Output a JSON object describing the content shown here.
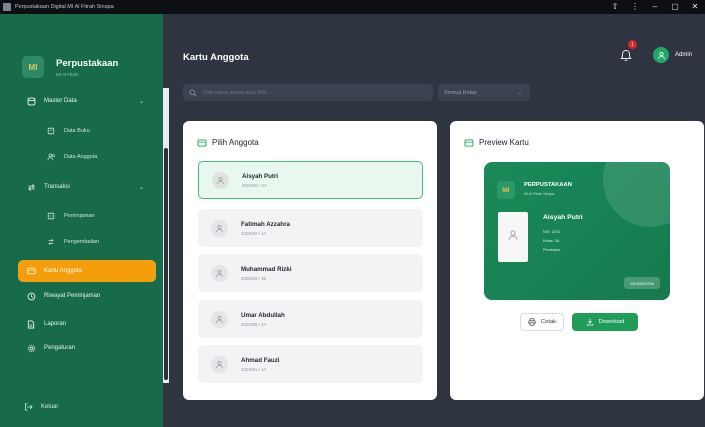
{
  "window": {
    "title": "Perpustakaan Digital MI Al Fitrah Sinapa",
    "controls": [
      "⇧",
      "⋮",
      "–",
      "▢",
      "✕"
    ]
  },
  "sidebar": {
    "brand_title": "Perpustakaan",
    "brand_subtitle": "MI Al Fitrah",
    "brand_logo": "MI",
    "items": [
      {
        "label": "Master Data",
        "icon": "database-icon",
        "expandable": true
      },
      {
        "label": "Data Buku",
        "icon": "book-icon",
        "sub": true
      },
      {
        "label": "Data Anggota",
        "icon": "users-icon",
        "sub": true
      },
      {
        "label": "Transaksi",
        "icon": "exchange-icon",
        "expandable": true
      },
      {
        "label": "Peminjaman",
        "icon": "book-out-icon",
        "sub": true
      },
      {
        "label": "Pengembalian",
        "icon": "return-icon",
        "sub": true
      },
      {
        "label": "Kartu Anggota",
        "icon": "id-card-icon",
        "active": true
      },
      {
        "label": "Riwayat Peminjaman",
        "icon": "history-icon"
      },
      {
        "label": "Laporan",
        "icon": "report-icon"
      },
      {
        "label": "Pengaturan",
        "icon": "settings-icon"
      }
    ],
    "logout_label": "Keluar"
  },
  "header": {
    "page_title": "Kartu Anggota",
    "notification_count": "1",
    "user_name": "Admin"
  },
  "search": {
    "placeholder": "Cari nama siswa atau NIS...",
    "filter_label": "Semua Kelas"
  },
  "member_panel": {
    "title": "Pilih Anggota",
    "members": [
      {
        "name": "Aisyah Putri",
        "info": "2024001 • 2A",
        "selected": true
      },
      {
        "name": "Fatimah Azzahra",
        "info": "2024002 • 1A",
        "selected": false
      },
      {
        "name": "Muhammad Rizki",
        "info": "2024003 • 1B",
        "selected": false
      },
      {
        "name": "Umar Abdullah",
        "info": "2024005 • 2A",
        "selected": false
      },
      {
        "name": "Ahmad Fauzi",
        "info": "2024001 • 1A",
        "selected": false
      }
    ]
  },
  "preview_panel": {
    "title": "Preview Kartu",
    "card": {
      "library_name": "PERPUSTAKAAN",
      "library_subtitle": "MI Al Fitrah Sinapa",
      "logo": "MI",
      "member_name": "Aisyah Putri",
      "nis_line": "NIS: 1234",
      "class_line": "Kelas: 2A",
      "status_line": "Peminjam",
      "code": "MI-00001234"
    },
    "print_label": "Cetak",
    "download_label": "Download"
  },
  "colors": {
    "sidebar": "#176b4a",
    "active": "#f59e0b",
    "accent_green": "#1f9d58",
    "background": "#2f3540"
  }
}
